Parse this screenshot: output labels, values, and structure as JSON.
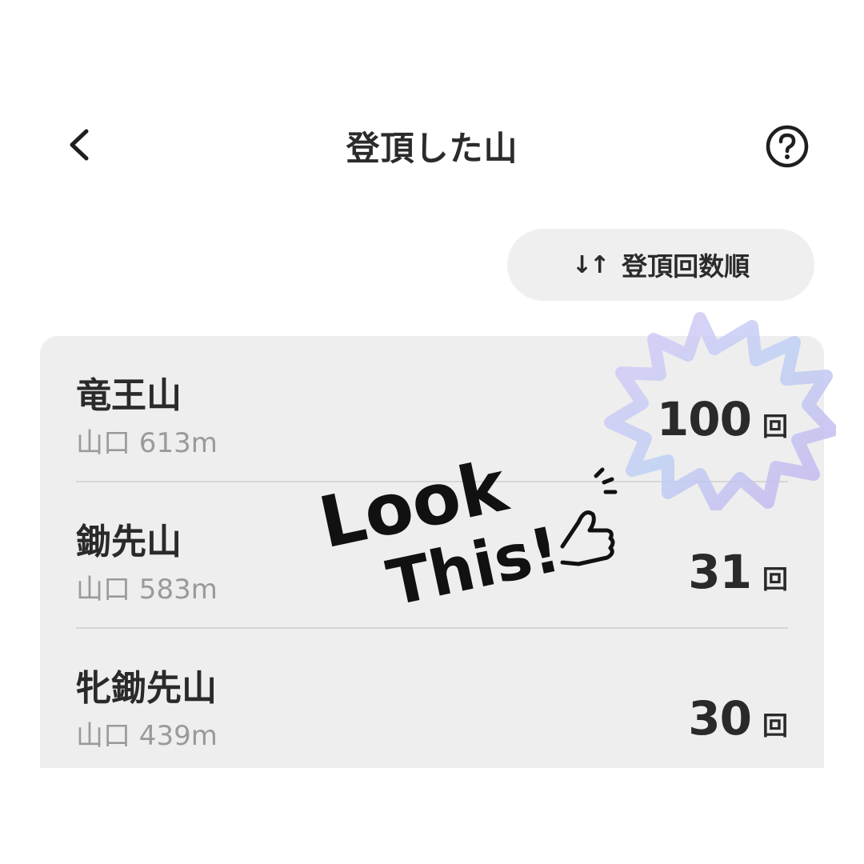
{
  "header": {
    "title": "登頂した山",
    "back_icon": "chevron-left-icon",
    "help_icon": "question-circle-icon"
  },
  "sort": {
    "icon": "↓↑",
    "label": "登頂回数順"
  },
  "mountains": [
    {
      "name": "竜王山",
      "location": "山口 613m",
      "count": "100",
      "unit": "回"
    },
    {
      "name": "鋤先山",
      "location": "山口 583m",
      "count": "31",
      "unit": "回"
    },
    {
      "name": "牝鋤先山",
      "location": "山口 439m",
      "count": "30",
      "unit": "回"
    }
  ],
  "sticker": {
    "line1": "Look",
    "line2": "This!",
    "icon": "thumbs-up-hand-icon",
    "burst_color": "#c9b6ee"
  }
}
